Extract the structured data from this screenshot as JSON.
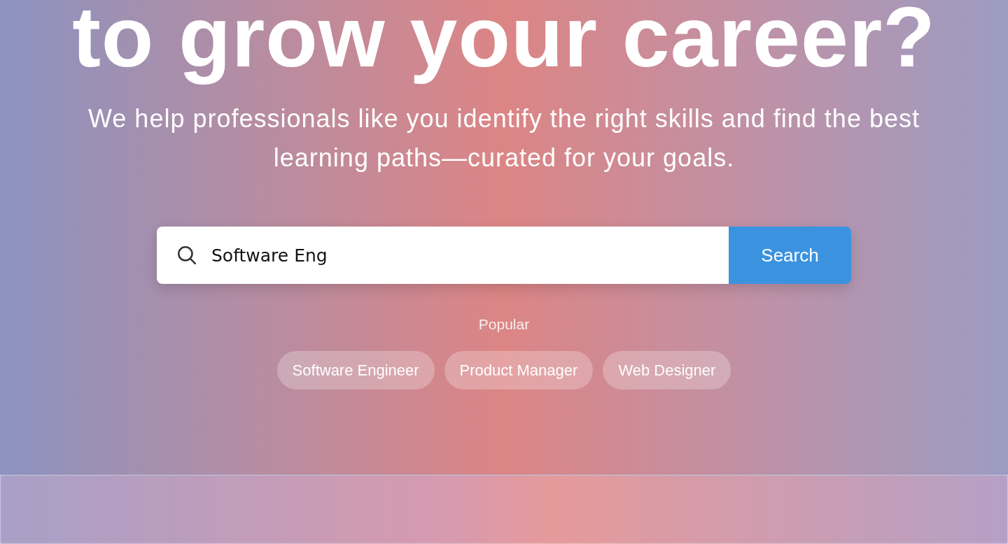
{
  "hero": {
    "heading": "to grow your career?",
    "subtitle": "We help professionals like you identify the right skills and find the best learning paths—curated for your goals."
  },
  "search": {
    "value": "Software Eng",
    "button": "Search"
  },
  "popular": {
    "label": "Popular",
    "chips": [
      "Software Engineer",
      "Product Manager",
      "Web Designer"
    ]
  }
}
